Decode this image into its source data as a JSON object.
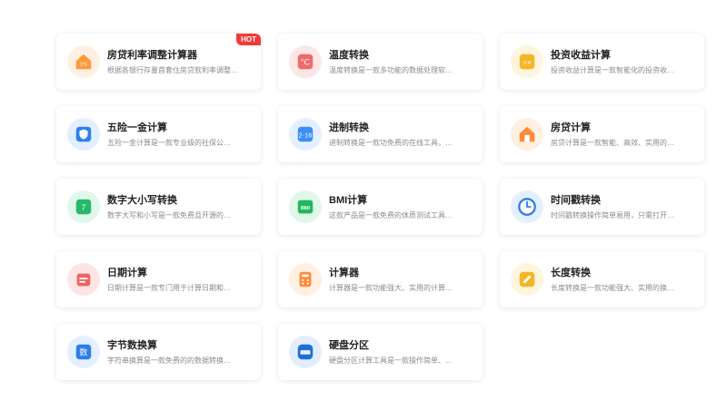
{
  "tools": [
    {
      "title": "房贷利率调整计算器",
      "desc": "根据各银行存量首套住房贷款利率调整…",
      "badge": "HOT",
      "icon": "house-rate-icon",
      "color": "#ff9a3c",
      "bg": "#fff1e2"
    },
    {
      "title": "温度转换",
      "desc": "温度转换是一款多功能的数据处理软…",
      "badge": "",
      "icon": "temperature-icon",
      "color": "#f06a6a",
      "bg": "#fde6e6"
    },
    {
      "title": "投资收益计算",
      "desc": "投资收益计算是一款智能化的投资收…",
      "badge": "",
      "icon": "investment-icon",
      "color": "#f5b52a",
      "bg": "#fff5dc"
    },
    {
      "title": "五险一金计算",
      "desc": "五险一金计算是一款专业级的社保公…",
      "badge": "",
      "icon": "insurance-shield-icon",
      "color": "#2d7ff0",
      "bg": "#e3efff"
    },
    {
      "title": "进制转换",
      "desc": "进制转换是一款功免费的在线工具，…",
      "badge": "",
      "icon": "base-convert-icon",
      "color": "#3a8ef6",
      "bg": "#e4f0ff"
    },
    {
      "title": "房贷计算",
      "desc": "房贷计算是一款智能、高效、实用的…",
      "badge": "",
      "icon": "house-loan-icon",
      "color": "#ff8a3a",
      "bg": "#fff0e2"
    },
    {
      "title": "数字大小写转换",
      "desc": "数字大写和小写是一款免费且开源的…",
      "badge": "",
      "icon": "number-case-icon",
      "color": "#27b86a",
      "bg": "#e2f7ec"
    },
    {
      "title": "BMI计算",
      "desc": "这款产品是一款免费的体质测试工具…",
      "badge": "",
      "icon": "bmi-icon",
      "color": "#1fb95a",
      "bg": "#e1f7e9"
    },
    {
      "title": "时间戳转换",
      "desc": "时间戳转换操作简单易用，只需打开…",
      "badge": "",
      "icon": "clock-icon",
      "color": "#2e7de8",
      "bg": "#e4efff"
    },
    {
      "title": "日期计算",
      "desc": "日期计算是一款专门用于计算日期和…",
      "badge": "",
      "icon": "calendar-icon",
      "color": "#f06262",
      "bg": "#fde5e5"
    },
    {
      "title": "计算器",
      "desc": "计算器是一款功能强大、实用的计算…",
      "badge": "",
      "icon": "calculator-icon",
      "color": "#ff8a3a",
      "bg": "#fff0e2"
    },
    {
      "title": "长度转换",
      "desc": "长度转换是一款功能强大、实用的换…",
      "badge": "",
      "icon": "ruler-icon",
      "color": "#f5b52a",
      "bg": "#fff5dc"
    },
    {
      "title": "字节数换算",
      "desc": "字符串换算是一款免费的的数据转换…",
      "badge": "",
      "icon": "byte-count-icon",
      "color": "#2e7de8",
      "bg": "#e4efff"
    },
    {
      "title": "硬盘分区",
      "desc": "硬盘分区计算工具是一款操作简单、…",
      "badge": "",
      "icon": "disk-partition-icon",
      "color": "#1e6fd9",
      "bg": "#e2eeff"
    }
  ]
}
